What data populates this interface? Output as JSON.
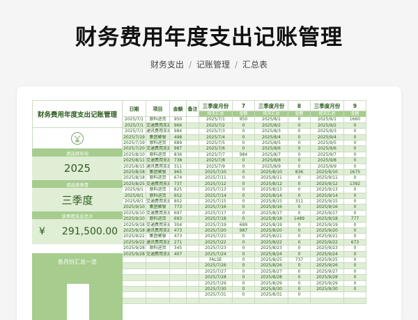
{
  "header": {
    "title": "财务费用年度支出记账管理",
    "breadcrumb": [
      "财务支出",
      "记账管理",
      "汇总表"
    ]
  },
  "panel": {
    "title": "财务费用年度支出记账管理",
    "year_label": "请选择年份",
    "year": "2025",
    "quarter_label": "请选择季度",
    "quarter": "三季度",
    "total_label": "该季度支出总计",
    "currency": "¥",
    "total": "291,500.00",
    "chart_title": "各月份汇总一览"
  },
  "ledger": {
    "columns": [
      "日期",
      "项目",
      "金额",
      "备注"
    ],
    "rows": [
      [
        "2025/7/1",
        "原料进货",
        "950",
        ""
      ],
      [
        "2025/7/1",
        "交通费用支出",
        "966",
        ""
      ],
      [
        "2025/7/1",
        "通讯费用支出",
        "984",
        ""
      ],
      [
        "2025/7/19",
        "集团聚餐",
        "498",
        ""
      ],
      [
        "2025/7/19",
        "原料进货",
        "689",
        ""
      ],
      [
        "2025/7/20",
        "交通费用支出",
        "987",
        ""
      ],
      [
        "2025/8/10",
        "原料进货",
        "836",
        ""
      ],
      [
        "2025/8/11",
        "交通费用支出",
        "738",
        ""
      ],
      [
        "2025/8/15",
        "通讯费用支出",
        "311",
        ""
      ],
      [
        "2025/8/18",
        "集团聚餐",
        "965",
        ""
      ],
      [
        "2025/8/18",
        "原料进货",
        "674",
        ""
      ],
      [
        "2025/8/25",
        "交通费用支出",
        "737",
        ""
      ],
      [
        "2025/9/1",
        "原料进货",
        "825",
        ""
      ],
      [
        "2025/9/1",
        "原料进货",
        "652",
        ""
      ],
      [
        "2025/9/1",
        "交通费用支出",
        "802",
        ""
      ],
      [
        "2025/9/10",
        "集团聚餐",
        "773",
        ""
      ],
      [
        "2025/9/10",
        "交通费用支出",
        "697",
        ""
      ],
      [
        "2025/9/10",
        "原料进货",
        "693",
        ""
      ],
      [
        "2025/9/18",
        "交通费用支出",
        "304",
        ""
      ],
      [
        "2025/9/18",
        "通讯费用支出",
        "473",
        ""
      ],
      [
        "2025/9/22",
        "集团聚餐",
        "473",
        ""
      ],
      [
        "2025/9/22",
        "通讯费用支出",
        "271",
        ""
      ],
      [
        "2025/9/28",
        "原料进货",
        "345",
        ""
      ],
      [
        "2025/9/28",
        "交通费用支出",
        "407",
        ""
      ],
      [
        "",
        "",
        "",
        ""
      ],
      [
        "",
        "",
        "",
        ""
      ],
      [
        "",
        "",
        "",
        ""
      ],
      [
        "",
        "",
        "",
        ""
      ],
      [
        "",
        "",
        "",
        ""
      ],
      [
        "",
        "",
        "",
        ""
      ],
      [
        "",
        "",
        "",
        ""
      ],
      [
        "",
        "",
        "",
        ""
      ]
    ]
  },
  "months": [
    {
      "label": "三季度月份",
      "month": "7",
      "sub": [
        "按天汇总",
        "金额"
      ],
      "rows": [
        [
          "2025/7/1",
          "950"
        ],
        [
          "2025/7/2",
          "0"
        ],
        [
          "2025/7/3",
          "0"
        ],
        [
          "2025/7/4",
          "0"
        ],
        [
          "2025/7/5",
          "0"
        ],
        [
          "2025/7/6",
          "0"
        ],
        [
          "2025/7/7",
          "984"
        ],
        [
          "2025/7/8",
          "0"
        ],
        [
          "2025/7/9",
          "0"
        ],
        [
          "2025/7/10",
          "0"
        ],
        [
          "2025/7/11",
          "0"
        ],
        [
          "2025/7/12",
          "0"
        ],
        [
          "2025/7/13",
          "0"
        ],
        [
          "2025/7/14",
          "0"
        ],
        [
          "2025/7/15",
          "0"
        ],
        [
          "2025/7/16",
          "0"
        ],
        [
          "2025/7/17",
          "0"
        ],
        [
          "2025/7/18",
          "0"
        ],
        [
          "2025/7/19",
          "689"
        ],
        [
          "2025/7/20",
          "987"
        ],
        [
          "2025/7/21",
          "0"
        ],
        [
          "2025/7/22",
          "0"
        ],
        [
          "2025/7/23",
          "0"
        ],
        [
          "2025/7/24",
          "0"
        ],
        [
          "FALSE",
          "0"
        ],
        [
          "2025/7/26",
          "0"
        ],
        [
          "2025/7/27",
          "0"
        ],
        [
          "2025/7/28",
          "0"
        ],
        [
          "2025/7/29",
          "0"
        ],
        [
          "2025/7/30",
          "0"
        ],
        [
          "2025/7/31",
          "0"
        ],
        [
          "",
          ""
        ]
      ]
    },
    {
      "label": "三季度月份",
      "month": "8",
      "sub": [
        "按天汇总",
        "金额"
      ],
      "rows": [
        [
          "2025/8/1",
          "0"
        ],
        [
          "2025/8/2",
          "0"
        ],
        [
          "2025/8/3",
          "0"
        ],
        [
          "2025/8/4",
          "0"
        ],
        [
          "2025/8/5",
          "0"
        ],
        [
          "2025/8/6",
          "0"
        ],
        [
          "2025/8/7",
          "0"
        ],
        [
          "2025/8/8",
          "0"
        ],
        [
          "2025/8/9",
          "0"
        ],
        [
          "2025/8/10",
          "836"
        ],
        [
          "2025/8/11",
          "0"
        ],
        [
          "2025/8/12",
          "0"
        ],
        [
          "2025/8/13",
          "0"
        ],
        [
          "2025/8/14",
          "0"
        ],
        [
          "2025/8/15",
          "311"
        ],
        [
          "2025/8/16",
          "0"
        ],
        [
          "2025/8/17",
          "0"
        ],
        [
          "2025/8/18",
          "1489"
        ],
        [
          "2025/8/19",
          "0"
        ],
        [
          "2025/8/20",
          "0"
        ],
        [
          "2025/8/21",
          "0"
        ],
        [
          "2025/8/22",
          "0"
        ],
        [
          "2025/8/23",
          "0"
        ],
        [
          "2025/8/24",
          "0"
        ],
        [
          "2025/8/25",
          "737"
        ],
        [
          "2025/8/26",
          "0"
        ],
        [
          "2025/8/27",
          "0"
        ],
        [
          "2025/8/28",
          "0"
        ],
        [
          "2025/8/29",
          "0"
        ],
        [
          "2025/8/30",
          "0"
        ],
        [
          "2025/8/31",
          "0"
        ],
        [
          "",
          ""
        ]
      ]
    },
    {
      "label": "三季度月份",
      "month": "9",
      "sub": [
        "按天汇总",
        "金额"
      ],
      "rows": [
        [
          "2025/9/1",
          "1660"
        ],
        [
          "2025/9/2",
          "0"
        ],
        [
          "2025/9/3",
          "0"
        ],
        [
          "2025/9/4",
          "0"
        ],
        [
          "2025/9/5",
          "0"
        ],
        [
          "2025/9/6",
          "0"
        ],
        [
          "2025/9/7",
          "0"
        ],
        [
          "2025/9/8",
          "0"
        ],
        [
          "2025/9/9",
          "0"
        ],
        [
          "2025/9/10",
          "1675"
        ],
        [
          "2025/9/11",
          "0"
        ],
        [
          "2025/9/12",
          "1392"
        ],
        [
          "2025/9/13",
          "0"
        ],
        [
          "2025/9/14",
          "0"
        ],
        [
          "2025/9/15",
          "0"
        ],
        [
          "2025/9/16",
          "0"
        ],
        [
          "2025/9/17",
          "0"
        ],
        [
          "2025/9/18",
          "777"
        ],
        [
          "2025/9/19",
          "0"
        ],
        [
          "2025/9/20",
          "0"
        ],
        [
          "2025/9/21",
          "0"
        ],
        [
          "2025/9/22",
          "673"
        ],
        [
          "2025/9/23",
          "0"
        ],
        [
          "2025/9/24",
          "0"
        ],
        [
          "2025/9/25",
          "0"
        ],
        [
          "2025/9/26",
          "0"
        ],
        [
          "2025/9/27",
          "0"
        ],
        [
          "2025/9/28",
          "0"
        ],
        [
          "2025/9/29",
          "0"
        ],
        [
          "2025/9/30",
          "0"
        ],
        [
          "",
          ""
        ],
        [
          "",
          ""
        ]
      ]
    }
  ],
  "colors": {
    "accent": "#a6cc8e",
    "accent_light": "#dfeed5",
    "text": "#2d5a1f"
  },
  "icons": {
    "logo": "dollar-leaf-logo-icon"
  }
}
